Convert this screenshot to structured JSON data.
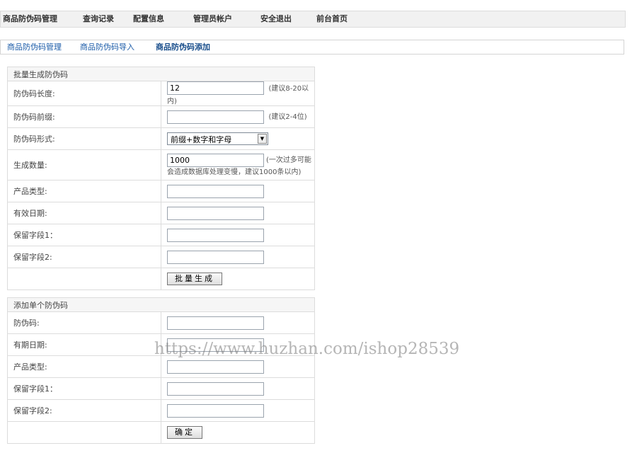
{
  "topnav": {
    "items": [
      "商品防伪码管理",
      "查询记录",
      "配置信息",
      "管理员帐户",
      "安全退出",
      "前台首页"
    ]
  },
  "subnav": {
    "items": [
      "商品防伪码管理",
      "商品防伪码导入",
      "商品防伪码添加"
    ],
    "active": "商品防伪码添加"
  },
  "batch_form": {
    "caption": "批量生成防伪码",
    "length_label": "防伪码长度:",
    "length_value": "12",
    "length_hint": "(建议8-20以内)",
    "prefix_label": "防伪码前缀:",
    "prefix_value": "",
    "prefix_hint": "(建议2-4位)",
    "format_label": "防伪码形式:",
    "format_value": "前缀+数字和字母",
    "count_label": "生成数量:",
    "count_value": "1000",
    "count_hint": "(一次过多可能会造成数据库处理变慢，建议1000条以内)",
    "product_type_label": "产品类型:",
    "expiry_label": "有效日期:",
    "reserve1_label": "保留字段1：",
    "reserve2_label": "保留字段2:",
    "submit_label": "批量生成"
  },
  "single_form": {
    "caption": "添加单个防伪码",
    "code_label": "防伪码:",
    "expiry_label": "有期日期:",
    "product_type_label": "产品类型:",
    "reserve1_label": "保留字段1：",
    "reserve2_label": "保留字段2:",
    "submit_label": "确定"
  },
  "watermark": "https://www.huzhan.com/ishop28539",
  "icons": {
    "select_arrow": "dropdown-arrow-icon"
  }
}
